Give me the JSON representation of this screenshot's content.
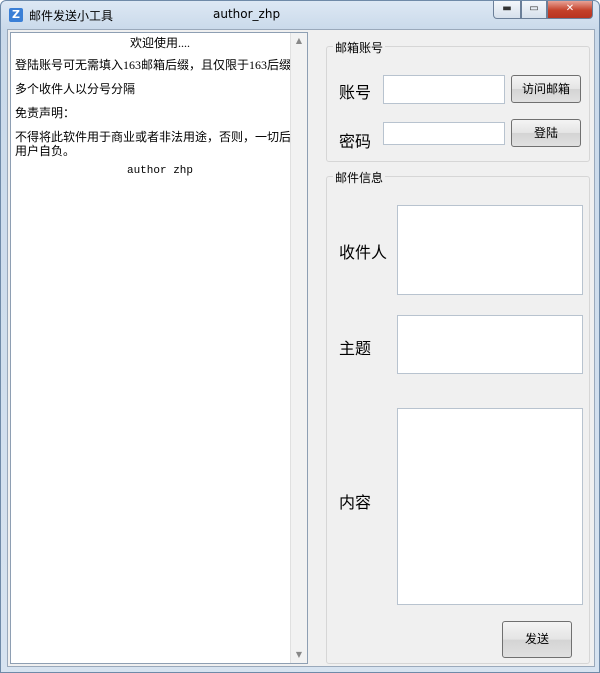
{
  "window": {
    "title": "邮件发送小工具",
    "author_title": "author_zhp",
    "icon_glyph": "Z",
    "controls": {
      "minimize": "▬",
      "maximize": "▭",
      "close": "✕"
    }
  },
  "info_text": {
    "welcome": "欢迎使用....",
    "line1": "登陆账号可无需填入163邮箱后缀，且仅限于163后缀邮箱",
    "line2": "多个收件人以分号分隔",
    "disclaimer_title": "免责声明：",
    "disclaimer_body_1": "不得将此软件用于商业或者非法用途，否则，一切后果请",
    "disclaimer_body_2": "用户自负。",
    "author": "author zhp"
  },
  "account_group": {
    "title": "邮箱账号",
    "account_label": "账号",
    "account_value": "",
    "password_label": "密码",
    "password_value": "",
    "visit_button": "访问邮箱",
    "login_button": "登陆"
  },
  "mail_group": {
    "title": "邮件信息",
    "recipient_label": "收件人",
    "recipient_value": "",
    "subject_label": "主题",
    "subject_value": "",
    "content_label": "内容",
    "content_value": ""
  },
  "send_button": "发送",
  "colors": {
    "close_button": "#c4412a",
    "form_background": "#f0f0f0"
  }
}
